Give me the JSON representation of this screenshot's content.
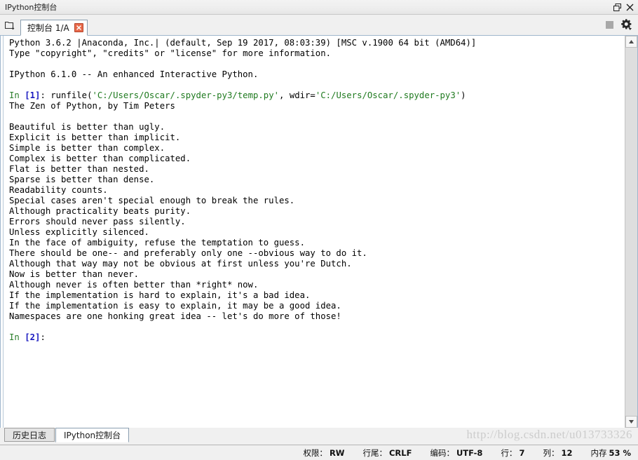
{
  "window": {
    "title": "IPython控制台",
    "undock_icon": "restore-window-icon",
    "close_icon": "close-icon"
  },
  "toolbar": {
    "browse_icon": "browse-tabs-icon",
    "tab_label": "控制台 1/A",
    "tab_close_icon": "close-tab-icon",
    "stop_icon": "stop-icon",
    "options_icon": "gear-icon"
  },
  "console": {
    "lines": [
      {
        "type": "plain",
        "text": "Python 3.6.2 |Anaconda, Inc.| (default, Sep 19 2017, 08:03:39) [MSC v.1900 64 bit (AMD64)]"
      },
      {
        "type": "plain",
        "text": "Type \"copyright\", \"credits\" or \"license\" for more information."
      },
      {
        "type": "blank",
        "text": ""
      },
      {
        "type": "plain",
        "text": "IPython 6.1.0 -- An enhanced Interactive Python."
      },
      {
        "type": "blank",
        "text": ""
      },
      {
        "type": "prompt",
        "prompt_in": "In ",
        "prompt_num": "[1]",
        "prompt_colon": ": ",
        "segments": [
          {
            "color": "black",
            "text": "runfile("
          },
          {
            "color": "green",
            "text": "'C:/Users/Oscar/.spyder-py3/temp.py'"
          },
          {
            "color": "black",
            "text": ", wdir="
          },
          {
            "color": "green",
            "text": "'C:/Users/Oscar/.spyder-py3'"
          },
          {
            "color": "black",
            "text": ")"
          }
        ]
      },
      {
        "type": "plain",
        "text": "The Zen of Python, by Tim Peters"
      },
      {
        "type": "blank",
        "text": ""
      },
      {
        "type": "plain",
        "text": "Beautiful is better than ugly."
      },
      {
        "type": "plain",
        "text": "Explicit is better than implicit."
      },
      {
        "type": "plain",
        "text": "Simple is better than complex."
      },
      {
        "type": "plain",
        "text": "Complex is better than complicated."
      },
      {
        "type": "plain",
        "text": "Flat is better than nested."
      },
      {
        "type": "plain",
        "text": "Sparse is better than dense."
      },
      {
        "type": "plain",
        "text": "Readability counts."
      },
      {
        "type": "plain",
        "text": "Special cases aren't special enough to break the rules."
      },
      {
        "type": "plain",
        "text": "Although practicality beats purity."
      },
      {
        "type": "plain",
        "text": "Errors should never pass silently."
      },
      {
        "type": "plain",
        "text": "Unless explicitly silenced."
      },
      {
        "type": "plain",
        "text": "In the face of ambiguity, refuse the temptation to guess."
      },
      {
        "type": "plain",
        "text": "There should be one-- and preferably only one --obvious way to do it."
      },
      {
        "type": "plain",
        "text": "Although that way may not be obvious at first unless you're Dutch."
      },
      {
        "type": "plain",
        "text": "Now is better than never."
      },
      {
        "type": "plain",
        "text": "Although never is often better than *right* now."
      },
      {
        "type": "plain",
        "text": "If the implementation is hard to explain, it's a bad idea."
      },
      {
        "type": "plain",
        "text": "If the implementation is easy to explain, it may be a good idea."
      },
      {
        "type": "plain",
        "text": "Namespaces are one honking great idea -- let's do more of those!"
      },
      {
        "type": "blank",
        "text": ""
      },
      {
        "type": "prompt",
        "prompt_in": "In ",
        "prompt_num": "[2]",
        "prompt_colon": ":",
        "segments": []
      }
    ],
    "scroll_up_icon": "chevron-up-icon",
    "scroll_down_icon": "chevron-down-icon"
  },
  "bottom_tabs": [
    {
      "label": "历史日志",
      "active": false
    },
    {
      "label": "IPython控制台",
      "active": true
    }
  ],
  "statusbar": {
    "items": [
      {
        "key": "权限：",
        "value": "RW"
      },
      {
        "key": "行尾：",
        "value": "CRLF"
      },
      {
        "key": "编码：",
        "value": "UTF-8"
      },
      {
        "key": "行：",
        "value": "7"
      },
      {
        "key": "列：",
        "value": "12"
      },
      {
        "key": "内存",
        "value": "53 %"
      }
    ]
  },
  "watermark": "http://blog.csdn.net/u013733326",
  "colors": {
    "string_green": "#1f7a1f",
    "prompt_blue": "#1919c0",
    "tab_close_red": "#e8694a",
    "chrome_gray": "#f0f0f0"
  }
}
